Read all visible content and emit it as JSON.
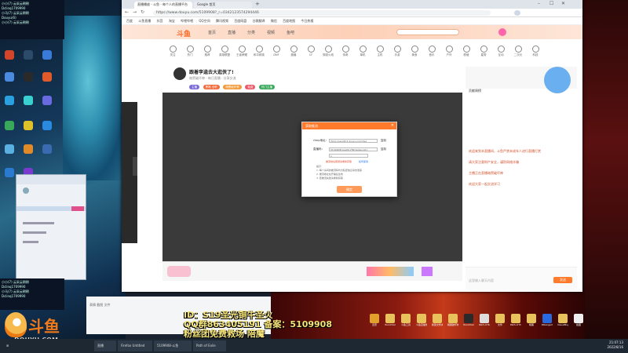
{
  "desktop": {
    "chat_top_lines": [
      "小小(7)  云采云朝朝",
      "Dclinq1709990",
      "小马(7)  云采云朝朝",
      "Douyu(6)",
      "小小(7)  云采云朝朝"
    ],
    "chat_bottom_lines": [
      "小小(7)  云采云朝朝",
      "Dclinq1709990",
      "小马(7)  云采云朝朝",
      "Dclinq1709990"
    ]
  },
  "browser": {
    "tabs": [
      {
        "label": "直播播放 - 斗鱼 - 每个人的直播平台"
      },
      {
        "label": "Google 首页"
      }
    ],
    "url": "https://www.douyu.com/5109908?_r=0342123574294446",
    "bookmarks": [
      "百度",
      "斗鱼直播",
      "抖音",
      "淘宝",
      "哔哩哔哩",
      "QQ空间",
      "腾讯视频",
      "百度网盘",
      "谷歌翻译",
      "微信",
      "百度地图",
      "今日热搜"
    ],
    "nav_items": [
      "关注",
      "热门",
      "推荐",
      "英雄联盟",
      "王者荣耀",
      "和平精英",
      "DNF",
      "魔兽",
      "CF",
      "穿越火线",
      "传奇",
      "单机",
      "主机",
      "手游",
      "美食",
      "音乐",
      "户外",
      "颜值",
      "星秀",
      "互动",
      "二次元",
      "科技",
      "体育",
      "赛事",
      "更多"
    ],
    "header_links": [
      "首页",
      "直播",
      "分类",
      "视频",
      "鱼吧"
    ]
  },
  "room": {
    "title": "跟着李逵去大逛侠了!",
    "subtitle": "暗黑破坏神 · 每日直播 · 分享交流",
    "tags": [
      {
        "label": "主播",
        "color": "#7a6ad8"
      },
      {
        "label": "黑暗 全职",
        "color": "#f26a3a"
      },
      {
        "label": "暗黑破坏神",
        "color": "#f29a3a"
      },
      {
        "label": "免费",
        "color": "#ea5a6a"
      },
      {
        "label": "热门主播",
        "color": "#3aa85a"
      }
    ]
  },
  "dialog": {
    "title": "获取推流",
    "rtmp_label": "rtmp地址：",
    "rtmp_value": "rtmp://sendtc3.douyu.com/live",
    "copy1": "复制",
    "key_label": "直播码：",
    "key_value": "5109908rLwsl8cVfN?wsSecret=",
    "copy2": "复制",
    "select_label": "",
    "select_value": "1",
    "error_text": "推流地址错误请重新获取",
    "help_link": "如何使用",
    "note_lines": [
      "提示：",
      "1. 每个房间的推流码均为私密信息请勿泄露",
      "2. 推流地址在开播后生效",
      "3. 若推流失败请重新获取"
    ],
    "ok_button": "确定"
  },
  "side": {
    "rank_title": "贡献周榜",
    "chat_lines": [
      "欢迎来到本直播间，斗鱼严禁未成年人进行直播打赏",
      "请大家注意财产安全，谨防网络诈骗",
      "主播正在直播暗黑破坏神",
      "欢迎大家一起交流学习"
    ],
    "input_placeholder": "这里输入聊天内容",
    "send_label": "发送"
  },
  "overlay": {
    "line1": "ID：S19圣光铜牛圣火",
    "line2": "QQ群863405191  备案：5109908",
    "line3": "粉丝团免费救场 陪魔"
  },
  "douyu": {
    "brand": "斗鱼",
    "url": "DOUYU.COM"
  },
  "qq_bottom_icons": [
    "表情",
    "截图",
    "文件"
  ],
  "desktop_icons": [
    "迅雷",
    "ToonCharms",
    "斗鱼工具",
    "斗鱼直播伴侣",
    "新建文件夹",
    "暗黑破坏神",
    "ToonCharms",
    "Path of Building",
    "文件",
    "Path of Exile",
    "暗黑",
    "DRangerX",
    "VisualBoy",
    "截图",
    "帮助",
    "Pubf"
  ],
  "taskbar": {
    "items": [
      "直播",
      "Firefox Untitled",
      "5109908-斗鱼",
      "Path of Exile"
    ],
    "time": "21:07:13",
    "date": "2022/8/16"
  }
}
